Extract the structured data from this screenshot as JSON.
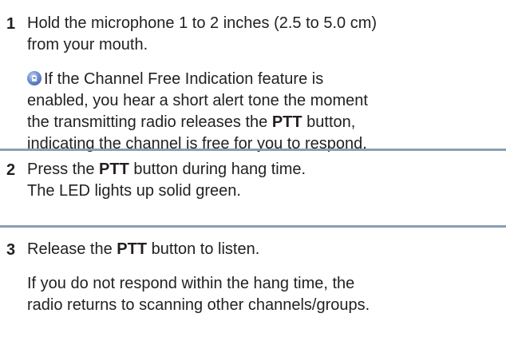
{
  "steps": [
    {
      "number": "1",
      "lines": [
        "Hold the microphone 1 to 2 inches (2.5 to 5.0 cm)",
        "from your mouth."
      ],
      "note": {
        "icon": "channel-free-indication-icon",
        "line1": "If the Channel Free Indication feature is",
        "line2": "enabled, you hear a short alert tone the moment",
        "line3_pre": "the transmitting radio releases the ",
        "line3_bold": "PTT",
        "line3_post": " button,",
        "line4": "indicating the channel is free for you to respond."
      }
    },
    {
      "number": "2",
      "line1_pre": "Press the ",
      "line1_bold": "PTT",
      "line1_post": " button during hang time.",
      "line2": "The LED lights up solid green."
    },
    {
      "number": "3",
      "line1_pre": "Release the ",
      "line1_bold": "PTT",
      "line1_post": " button to listen.",
      "detail_line1": "If you do not respond within the hang time, the",
      "detail_line2": "radio returns to scanning other channels/groups."
    }
  ],
  "colors": {
    "divider": "#8aa0b2",
    "text": "#231f20"
  }
}
